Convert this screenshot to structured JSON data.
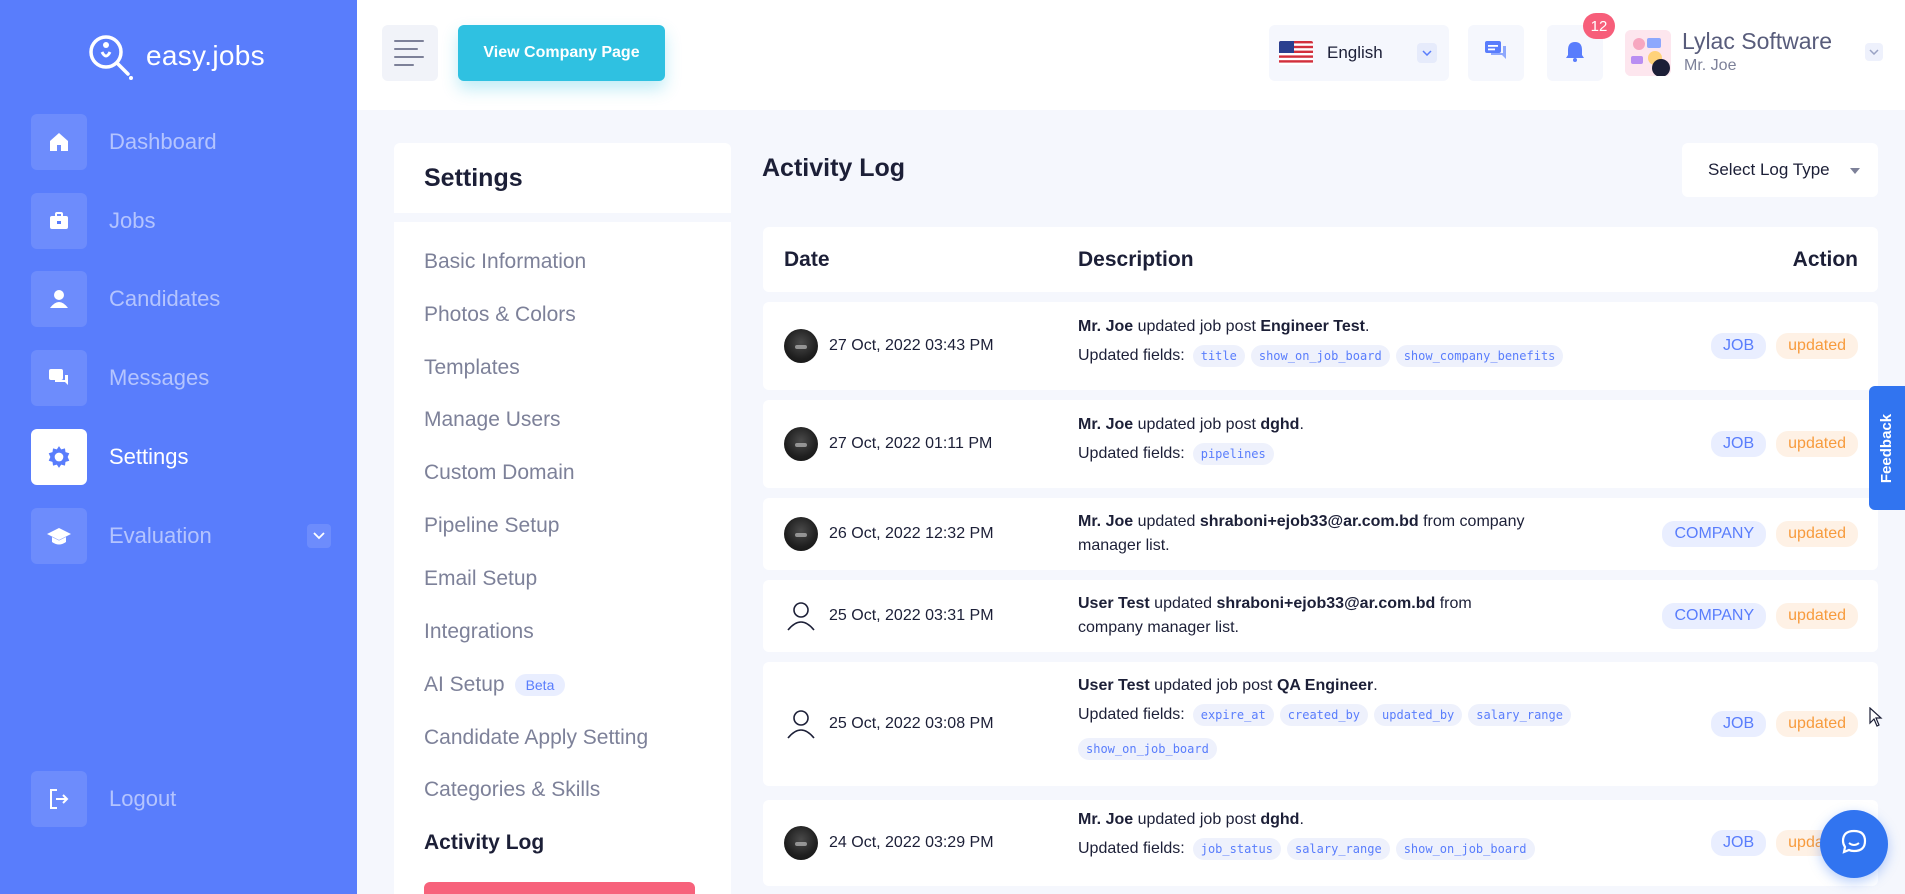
{
  "brand": {
    "name": "easy.jobs"
  },
  "sidebar": {
    "items": [
      {
        "label": "Dashboard",
        "icon": "home-icon"
      },
      {
        "label": "Jobs",
        "icon": "briefcase-icon"
      },
      {
        "label": "Candidates",
        "icon": "user-icon"
      },
      {
        "label": "Messages",
        "icon": "chat-icon"
      },
      {
        "label": "Settings",
        "icon": "gear-icon",
        "active": true
      },
      {
        "label": "Evaluation",
        "icon": "graduation-cap-icon"
      }
    ],
    "logout": "Logout"
  },
  "header": {
    "view_company_label": "View Company Page",
    "language": "English",
    "notification_count": "12",
    "company_name": "Lylac Software",
    "user_name": "Mr. Joe"
  },
  "settings": {
    "title": "Settings",
    "menu": [
      "Basic Information",
      "Photos & Colors",
      "Templates",
      "Manage Users",
      "Custom Domain",
      "Pipeline Setup",
      "Email Setup",
      "Integrations",
      "AI Setup",
      "Candidate Apply Setting",
      "Categories & Skills",
      "Activity Log"
    ],
    "beta_label": "Beta"
  },
  "activity_log": {
    "title": "Activity Log",
    "select_placeholder": "Select Log Type",
    "columns": {
      "date": "Date",
      "description": "Description",
      "action": "Action"
    },
    "rows": [
      {
        "date": "27 Oct, 2022 03:43 PM",
        "actor": "Mr. Joe",
        "verb": " updated job post ",
        "subject": "Engineer Test",
        "tail": ".",
        "fields_label": "Updated fields:",
        "fields": [
          "title",
          "show_on_job_board",
          "show_company_benefits"
        ],
        "type": "JOB",
        "action": "updated"
      },
      {
        "date": "27 Oct, 2022 01:11 PM",
        "actor": "Mr. Joe",
        "verb": " updated job post ",
        "subject": "dghd",
        "tail": ".",
        "fields_label": "Updated fields:",
        "fields": [
          "pipelines"
        ],
        "type": "JOB",
        "action": "updated"
      },
      {
        "date": "26 Oct, 2022 12:32 PM",
        "actor": "Mr. Joe",
        "verb": " updated ",
        "subject": "shraboni+ejob33@ar.com.bd",
        "tail": " from company manager list.",
        "type": "COMPANY",
        "action": "updated"
      },
      {
        "date": "25 Oct, 2022 03:31 PM",
        "actor": "User Test",
        "verb": " updated ",
        "subject": "shraboni+ejob33@ar.com.bd",
        "tail": " from company manager list.",
        "type": "COMPANY",
        "action": "updated"
      },
      {
        "date": "25 Oct, 2022 03:08 PM",
        "actor": "User Test",
        "verb": " updated job post ",
        "subject": "QA Engineer",
        "tail": ".",
        "fields_label": "Updated fields:",
        "fields": [
          "expire_at",
          "created_by",
          "updated_by",
          "salary_range",
          "show_on_job_board"
        ],
        "type": "JOB",
        "action": "updated"
      },
      {
        "date": "24 Oct, 2022 03:29 PM",
        "actor": "Mr. Joe",
        "verb": " updated job post ",
        "subject": "dghd",
        "tail": ".",
        "fields_label": "Updated fields:",
        "fields": [
          "job_status",
          "salary_range",
          "show_on_job_board"
        ],
        "type": "JOB",
        "action": "updated"
      }
    ]
  },
  "feedback_label": "Feedback",
  "colors": {
    "sidebar": "#597dfc",
    "accent_cyan": "#2fc1e1",
    "badge": "#f75e7a",
    "tag_job": "#597dfc",
    "tag_updated": "#f79b3d"
  }
}
